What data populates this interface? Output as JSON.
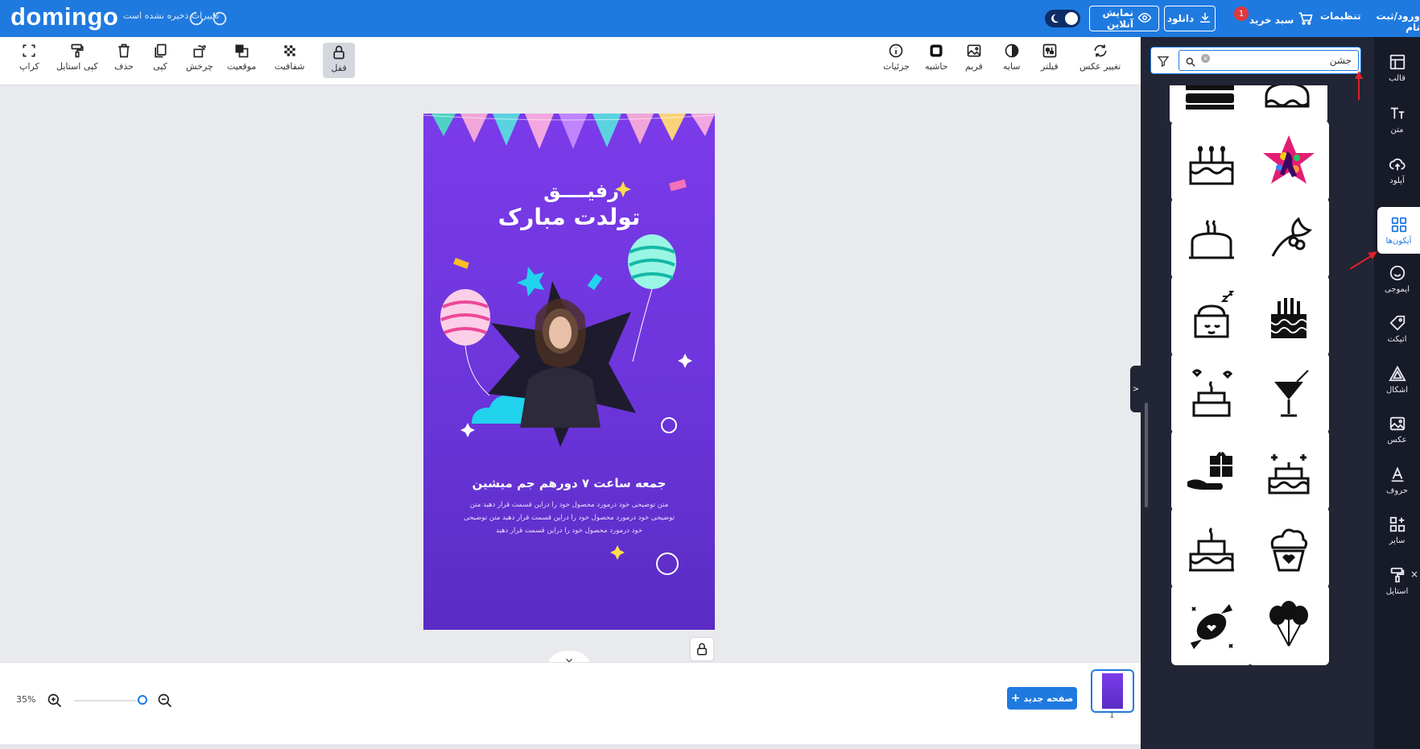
{
  "topbar": {
    "logo": "domingo",
    "unsaved_text": "تغییرات ذخیره نشده است",
    "online_preview": "نمایش آنلاین",
    "download": "دانلود",
    "cart": "سبد خرید",
    "cart_count": "1",
    "settings": "تنظیمات",
    "login": "ورود/ثبت نام"
  },
  "toolbar": {
    "crop": "کراپ",
    "copy_style": "کپی استایل",
    "delete": "حذف",
    "copy": "کپی",
    "rotate": "چرخش",
    "position": "موقعیت",
    "transparency": "شفافیت",
    "lock": "قفل",
    "details": "جزئیات",
    "border": "حاشیه",
    "frame": "فریم",
    "shadow": "سایه",
    "filter": "فیلتر",
    "change_photo": "تغییر عکس"
  },
  "design": {
    "title_line1": "رفیــــق",
    "title_line2": "تولدت مبارک",
    "subtitle": "جمعه ساعت ۷ دورهم جم میشین",
    "body": "متن توضیحی خود درمورد محصول خود را دراین قسمت قرار دهید متن توضیحی خود درمورد محصول خود را دراین قسمت قرار دهید متن توضیحی خود درمورد محصول خود را دراین قسمت قرار دهید"
  },
  "bottombar": {
    "zoom": "35%",
    "zoom_level": 0.35,
    "new_page": "صفحه جدید",
    "page_number": "1"
  },
  "panel": {
    "search_value": "جشن",
    "icons": [
      "cake-stripes",
      "cake-tiered-top",
      "cake-three-candles",
      "colorful-star-person",
      "cake-one-candle",
      "holly-leaves",
      "cake-sleeping",
      "cake-tall-candles",
      "cake-hearts",
      "cocktail-glass",
      "gift-hand",
      "cake-sparkles",
      "cake-layered",
      "cupcake-heart",
      "candy-heart",
      "balloons"
    ]
  },
  "rail": {
    "template": "قالب",
    "text": "متن",
    "upload": "آپلود",
    "icons": "آیکون‌ها",
    "emoji": "ایموجی",
    "sticker": "اتیکت",
    "shapes": "اشکال",
    "photo": "عکس",
    "letters": "حروف",
    "other": "سایر",
    "style": "استایل"
  },
  "colors": {
    "brand": "#1f7ae0",
    "panel": "#212535",
    "rail": "#171a27",
    "design_purple": "#7b3bea",
    "badge": "#e0393e",
    "arrow": "#e0202a"
  }
}
